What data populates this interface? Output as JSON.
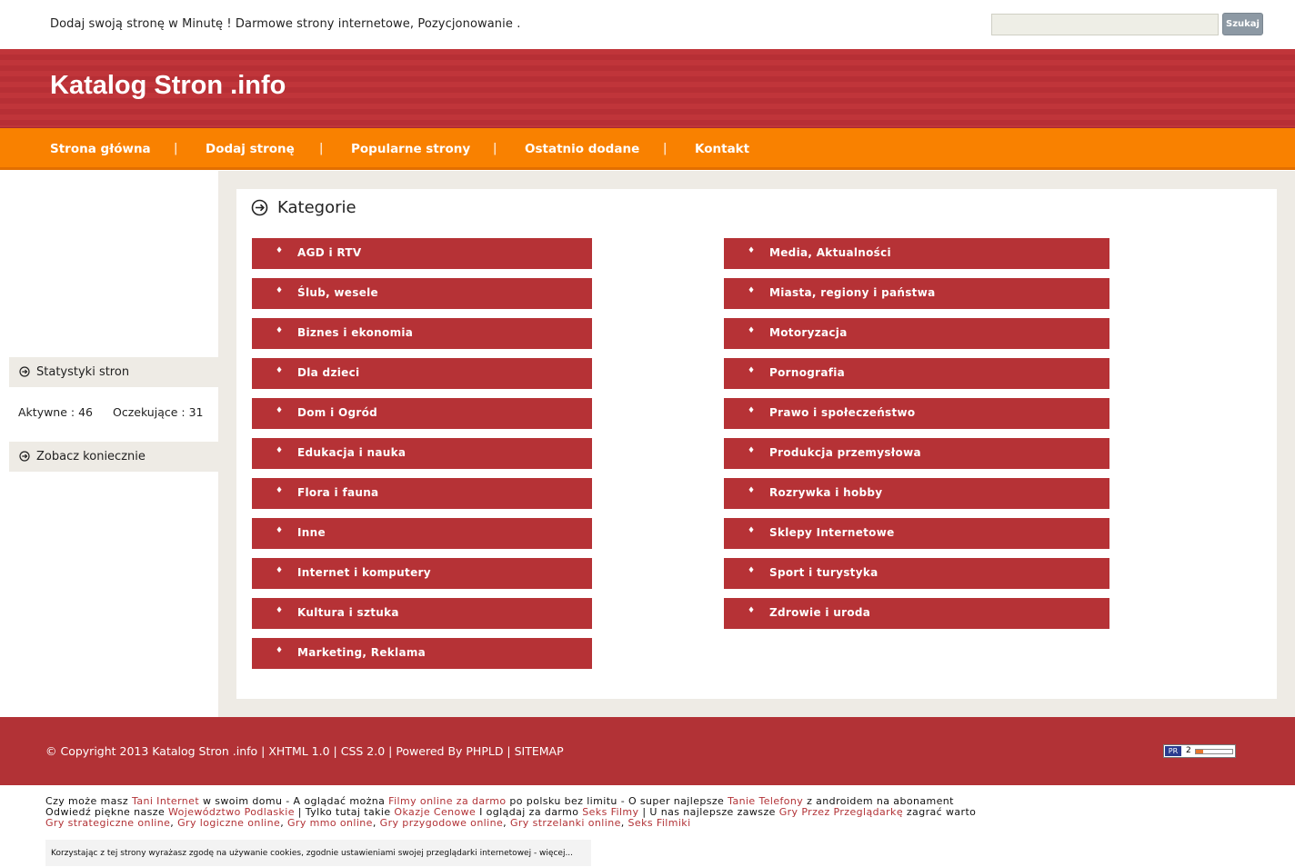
{
  "top": {
    "tagline": "Dodaj swoją stronę w Minutę ! Darmowe strony internetowe, Pozycjonowanie .",
    "search_placeholder": "",
    "search_button": "Szukaj"
  },
  "header": {
    "title": "Katalog Stron .info"
  },
  "nav": {
    "items": [
      "Strona główna",
      "Dodaj stronę",
      "Popularne strony",
      "Ostatnio dodane",
      "Kontakt"
    ],
    "separator": "|"
  },
  "sidebar": {
    "stats_title": "Statystyki stron",
    "active": "Aktywne : 46",
    "pending": "Oczekujące : 31",
    "see_title": "Zobacz koniecznie"
  },
  "main": {
    "title": "Kategorie",
    "bullet": "♦",
    "left_categories": [
      "AGD i RTV",
      "Ślub, wesele",
      "Biznes i ekonomia",
      "Dla dzieci",
      "Dom i Ogród",
      "Edukacja i nauka",
      "Flora i fauna",
      "Inne",
      "Internet i komputery",
      "Kultura i sztuka",
      "Marketing, Reklama"
    ],
    "right_categories": [
      "Media, Aktualności",
      "Miasta, regiony i państwa",
      "Motoryzacja",
      "Pornografia",
      "Prawo i społeczeństwo",
      "Produkcja przemysłowa",
      "Rozrywka i hobby",
      "Sklepy Internetowe",
      "Sport i turystyka",
      "Zdrowie i uroda"
    ]
  },
  "footer": {
    "copyright": "© Copyright 2013 Katalog Stron .info | XHTML 1.0 | CSS 2.0 | Powered By PHPLD | SITEMAP",
    "pr_label": "PR",
    "pr_value": "2",
    "pr_fraction": 0.2
  },
  "links": {
    "line1": {
      "t1": "Czy może masz ",
      "l1": "Tani Internet",
      "t2": " w swoim domu - A oglądać można ",
      "l2": "Filmy online za darmo",
      "t3": " po polsku bez limitu - O super najlepsze ",
      "l3": "Tanie Telefony",
      "t4": " z androidem na abonament"
    },
    "line2": {
      "t1": "Odwiedź piękne nasze ",
      "l1": "Województwo Podlaskie",
      "t2": " | Tylko tutaj takie ",
      "l2": "Okazje Cenowe",
      "t3": " I oglądaj za darmo ",
      "l3": "Seks Filmy",
      "t4": " | U nas najlepsze zawsze ",
      "l4": "Gry Przez Przeglądarkę",
      "t5": " zagrać warto"
    },
    "line3": [
      "Gry strategiczne online",
      "Gry logiczne online",
      "Gry mmo online",
      "Gry przygodowe online",
      "Gry strzelanki online",
      "Seks Filmiki"
    ]
  },
  "cookie": {
    "text": "Korzystając z tej strony wyrażasz zgodę na używanie cookies, zgodnie ustawieniami swojej przeglądarki internetowej - więcej..."
  }
}
